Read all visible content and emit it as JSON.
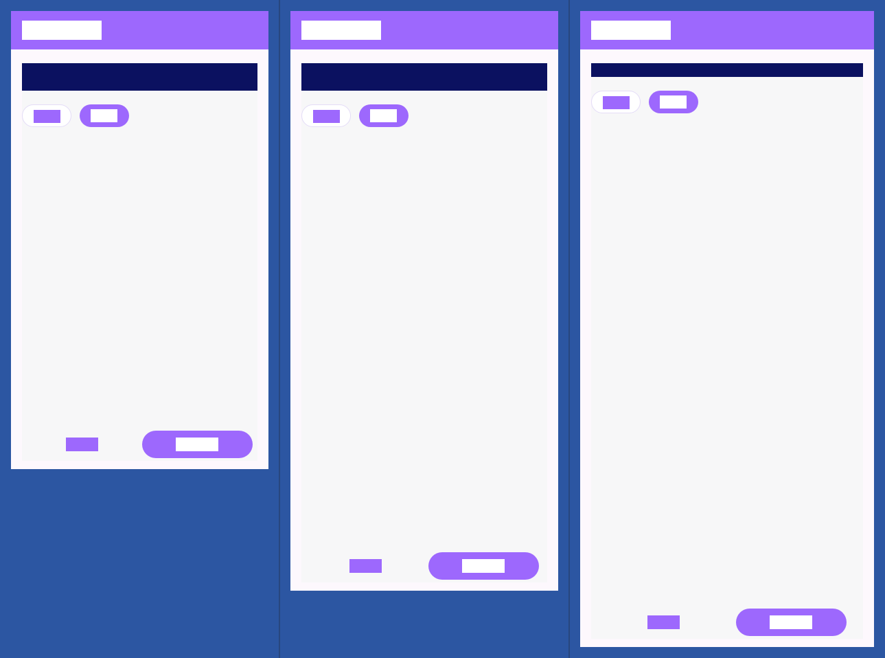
{
  "colors": {
    "background": "#2c56a2",
    "divider": "#28477f",
    "surface": "#fdf8fd",
    "content": "#f7f7f8",
    "primary": "#9d68fd",
    "headline": "#0b1160",
    "on_primary": "#ffffff"
  },
  "screens": [
    {
      "title": "",
      "headline": "",
      "chips": [
        {
          "label": "",
          "selected": false
        },
        {
          "label": "",
          "selected": true
        }
      ],
      "secondary_action": "",
      "primary_action": ""
    },
    {
      "title": "",
      "headline": "",
      "chips": [
        {
          "label": "",
          "selected": false
        },
        {
          "label": "",
          "selected": true
        }
      ],
      "secondary_action": "",
      "primary_action": ""
    },
    {
      "title": "",
      "headline": "",
      "chips": [
        {
          "label": "",
          "selected": false
        },
        {
          "label": "",
          "selected": true
        }
      ],
      "secondary_action": "",
      "primary_action": ""
    }
  ]
}
